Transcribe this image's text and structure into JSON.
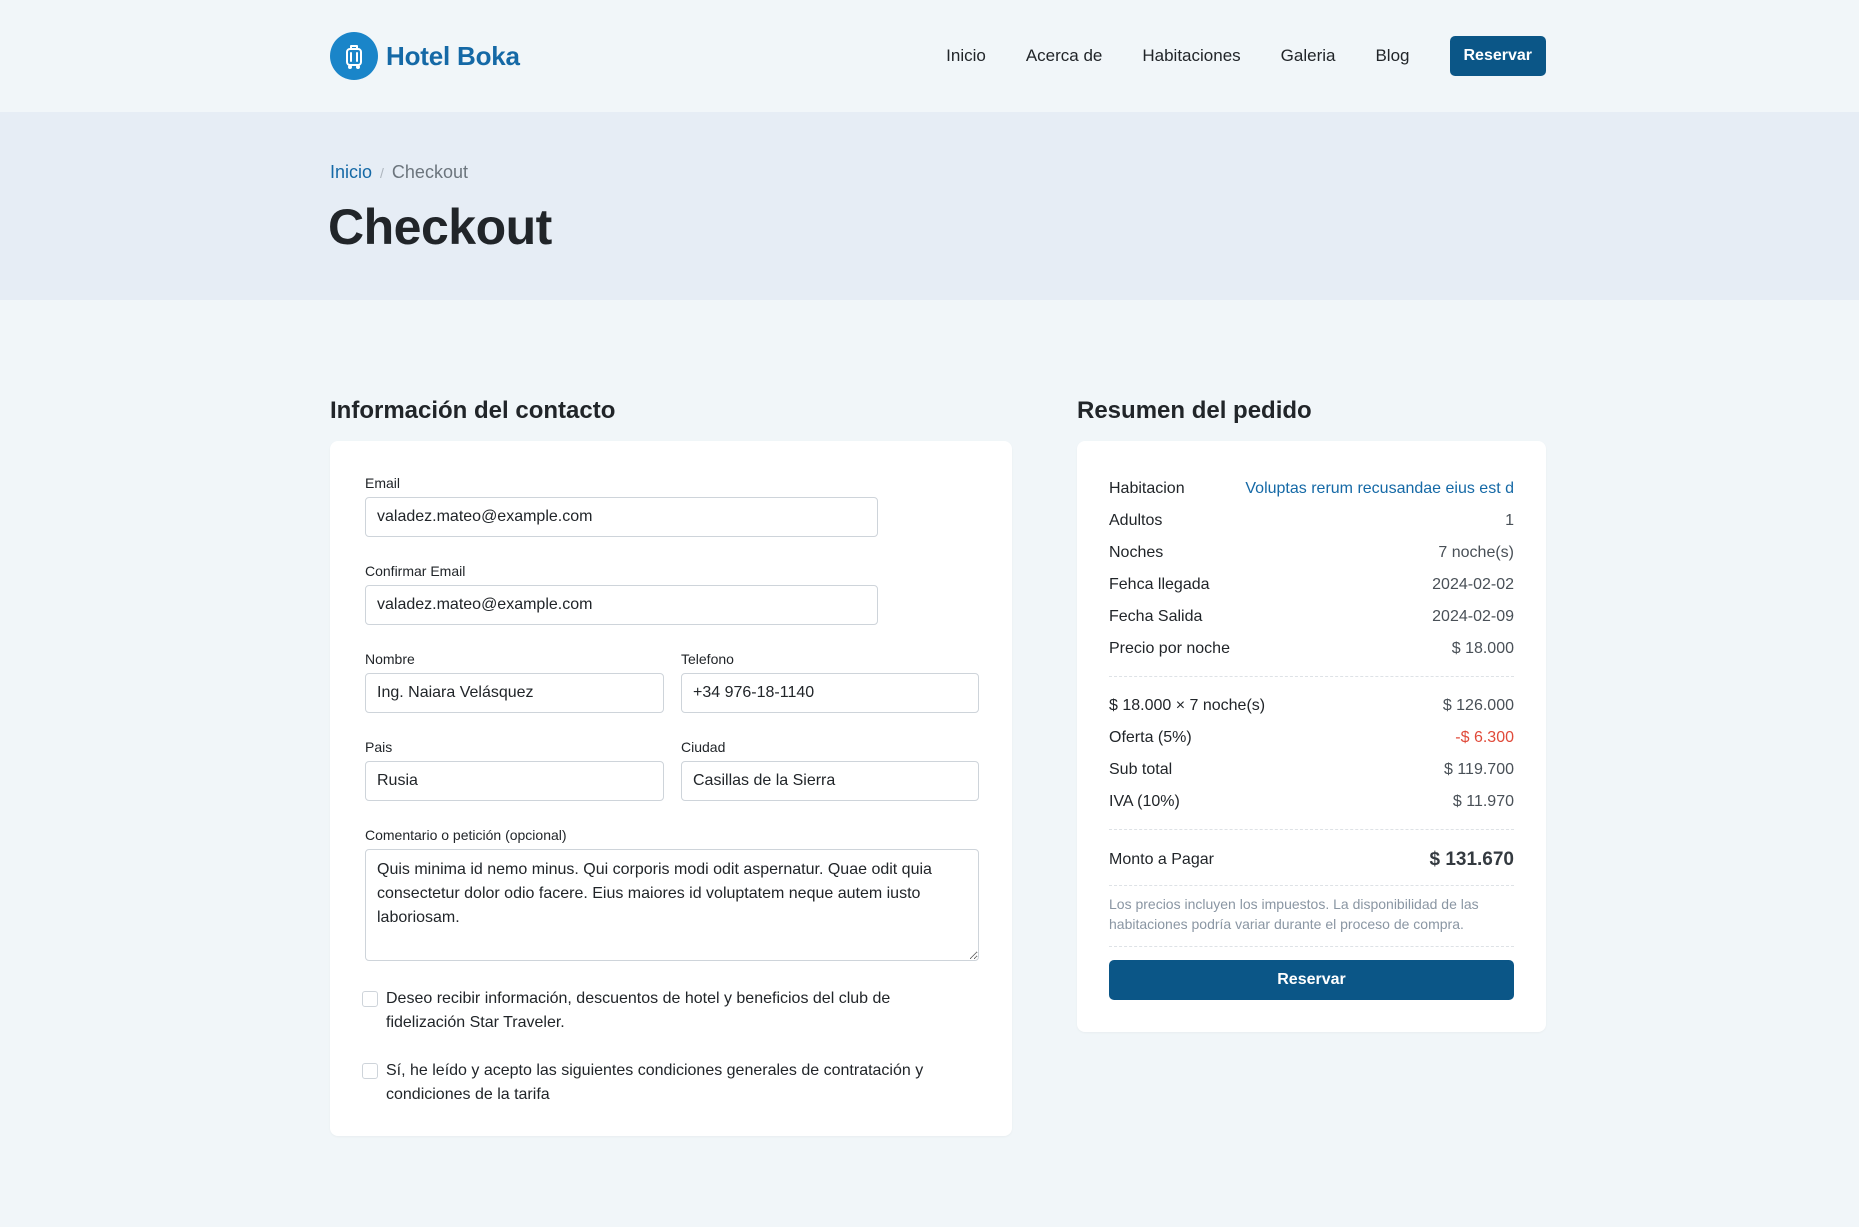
{
  "brand": {
    "name": "Hotel Boka"
  },
  "nav": {
    "items": [
      "Inicio",
      "Acerca de",
      "Habitaciones",
      "Galeria",
      "Blog"
    ],
    "cta": "Reservar"
  },
  "breadcrumb": {
    "home": "Inicio",
    "current": "Checkout"
  },
  "page": {
    "title": "Checkout"
  },
  "contact": {
    "title": "Información del contacto",
    "email_label": "Email",
    "email_value": "valadez.mateo@example.com",
    "confirm_email_label": "Confirmar Email",
    "confirm_email_value": "valadez.mateo@example.com",
    "name_label": "Nombre",
    "name_value": "Ing. Naiara Velásquez",
    "phone_label": "Telefono",
    "phone_value": "+34 976-18-1140",
    "country_label": "Pais",
    "country_value": "Rusia",
    "city_label": "Ciudad",
    "city_value": "Casillas de la Sierra",
    "comment_label": "Comentario o petición (opcional)",
    "comment_value": "Quis minima id nemo minus. Qui corporis modi odit aspernatur. Quae odit quia consectetur dolor odio facere. Eius maiores id voluptatem neque autem iusto laboriosam.",
    "newsletter_label": "Deseo recibir información, descuentos de hotel y beneficios del club de fidelización Star Traveler.",
    "terms_label": "Sí, he leído y acepto las siguientes condiciones generales de contratación y condiciones de la tarifa"
  },
  "summary": {
    "title": "Resumen del pedido",
    "room_label": "Habitacion",
    "room_value": "Voluptas rerum recusandae eius est d",
    "adults_label": "Adultos",
    "adults_value": "1",
    "nights_label": "Noches",
    "nights_value": "7 noche(s)",
    "checkin_label": "Fehca llegada",
    "checkin_value": "2024-02-02",
    "checkout_label": "Fecha Salida",
    "checkout_value": "2024-02-09",
    "price_label": "Precio por noche",
    "price_value": "$ 18.000",
    "calc_label": "$ 18.000 × 7 noche(s)",
    "calc_value": "$ 126.000",
    "offer_label": "Oferta (5%)",
    "offer_value": "-$ 6.300",
    "subtotal_label": "Sub total",
    "subtotal_value": "$ 119.700",
    "tax_label": "IVA (10%)",
    "tax_value": "$ 11.970",
    "total_label": "Monto a Pagar",
    "total_value": "$ 131.670",
    "note": "Los precios incluyen los impuestos. La disponibilidad de las habitaciones podría variar durante el proceso de compra.",
    "button": "Reservar"
  },
  "colors": {
    "primary": "#0b5687",
    "link": "#1569a6",
    "discount": "#e04a3a",
    "hero_bg": "#e6edf5",
    "page_bg": "#f1f6f9"
  }
}
